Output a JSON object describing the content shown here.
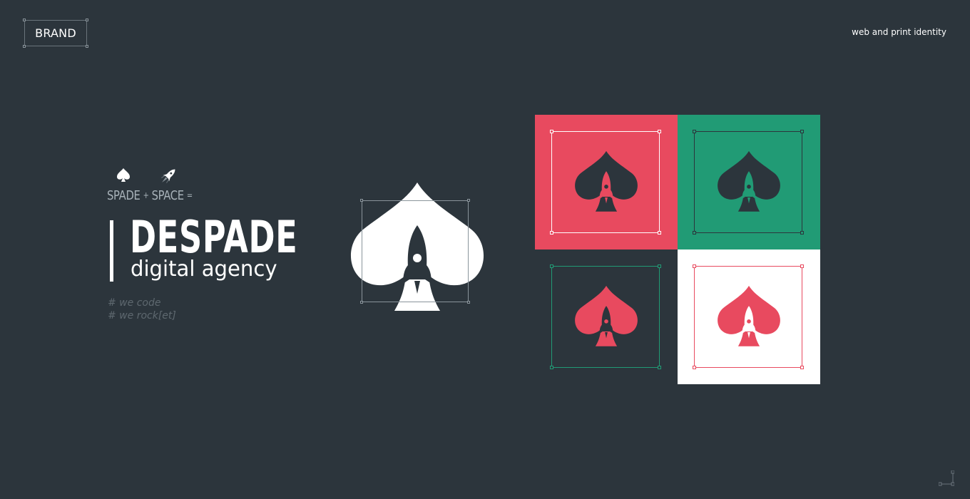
{
  "header": {
    "brand_label": "BRAND",
    "subtitle": "web and print identity"
  },
  "story": {
    "formula_word_1": "SPADE",
    "formula_op_1": "+",
    "formula_word_2": "SPACE",
    "formula_op_2": "=",
    "wordmark": "DESPADE",
    "tagline": "digital agency",
    "hashtags": [
      "# we code",
      "# we rock[et]"
    ],
    "formula_icons": [
      "spade-icon",
      "rocket-icon"
    ]
  },
  "logo": {
    "icon": "spade-rocket-icon",
    "color": "#ffffff",
    "rocket_color": "#2c353c"
  },
  "variants": [
    {
      "name": "red-background",
      "background": "#e84a5f",
      "spade": "#2c353c",
      "rocket": "#e84a5f",
      "frame": "#ffffff"
    },
    {
      "name": "green-background",
      "background": "#219b75",
      "spade": "#2c353c",
      "rocket": "#219b75",
      "frame": "#2c353c"
    },
    {
      "name": "dark-background",
      "background": "#2c353c",
      "spade": "#e84a5f",
      "rocket": "#2c353c",
      "frame": "#219b75"
    },
    {
      "name": "white-background",
      "background": "#ffffff",
      "spade": "#e84a5f",
      "rocket": "#ffffff",
      "frame": "#e84a5f"
    }
  ],
  "colors": {
    "page_background": "#2c353c",
    "red": "#e84a5f",
    "green": "#219b75",
    "white": "#ffffff"
  }
}
